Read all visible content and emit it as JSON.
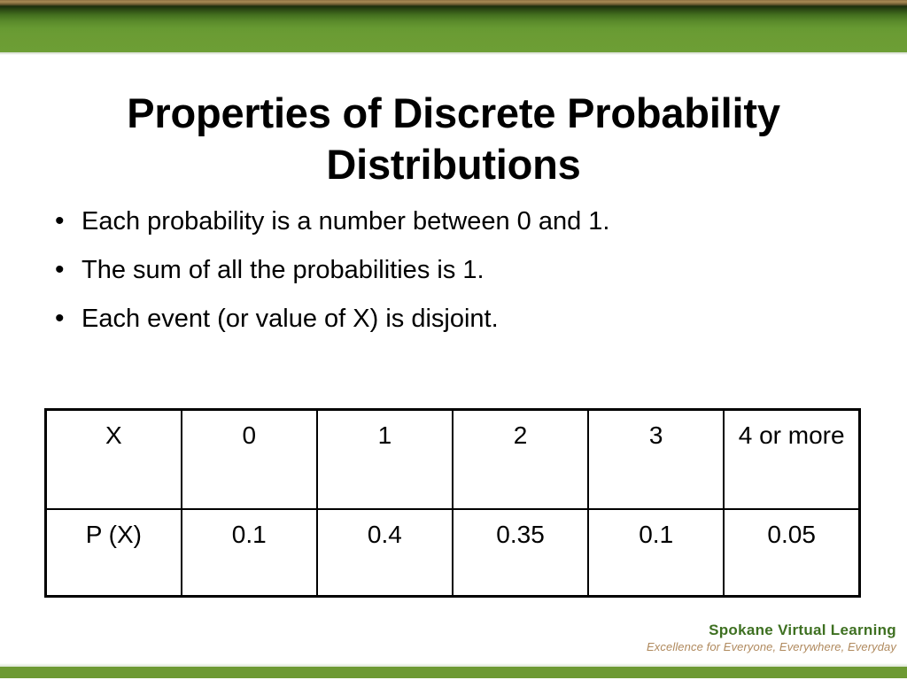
{
  "slide": {
    "title": "Properties of Discrete Probability Distributions",
    "bullet_marker": "•",
    "bullets": [
      "Each probability is a number between 0 and 1.",
      "The sum of all the probabilities is 1.",
      "Each event (or value of X) is disjoint."
    ]
  },
  "table": {
    "rows": [
      [
        "X",
        "0",
        "1",
        "2",
        "3",
        "4 or more"
      ],
      [
        "P (X)",
        "0.1",
        "0.4",
        "0.35",
        "0.1",
        "0.05"
      ]
    ]
  },
  "footer": {
    "organization": "Spokane Virtual Learning",
    "tagline": "Excellence for Everyone, Everywhere, Everyday"
  },
  "colors": {
    "band_green": "#6d9a33",
    "band_dark_green": "#1c2f0c",
    "band_tan": "#a98a55",
    "logo_green": "#3e7021",
    "logo_tan": "#b08a5e",
    "text_black": "#000000",
    "background": "#ffffff"
  },
  "chart_data": {
    "type": "table",
    "title": "Properties of Discrete Probability Distributions",
    "categories": [
      "0",
      "1",
      "2",
      "3",
      "4 or more"
    ],
    "values": [
      0.1,
      0.4,
      0.35,
      0.1,
      0.05
    ],
    "xlabel": "X",
    "ylabel": "P (X)",
    "series": [
      {
        "name": "P (X)",
        "values": [
          0.1,
          0.4,
          0.35,
          0.1,
          0.05
        ]
      }
    ],
    "annotations": [
      "Each probability is a number between 0 and 1.",
      "The sum of all the probabilities is 1.",
      "Each event (or value of X) is disjoint."
    ]
  }
}
